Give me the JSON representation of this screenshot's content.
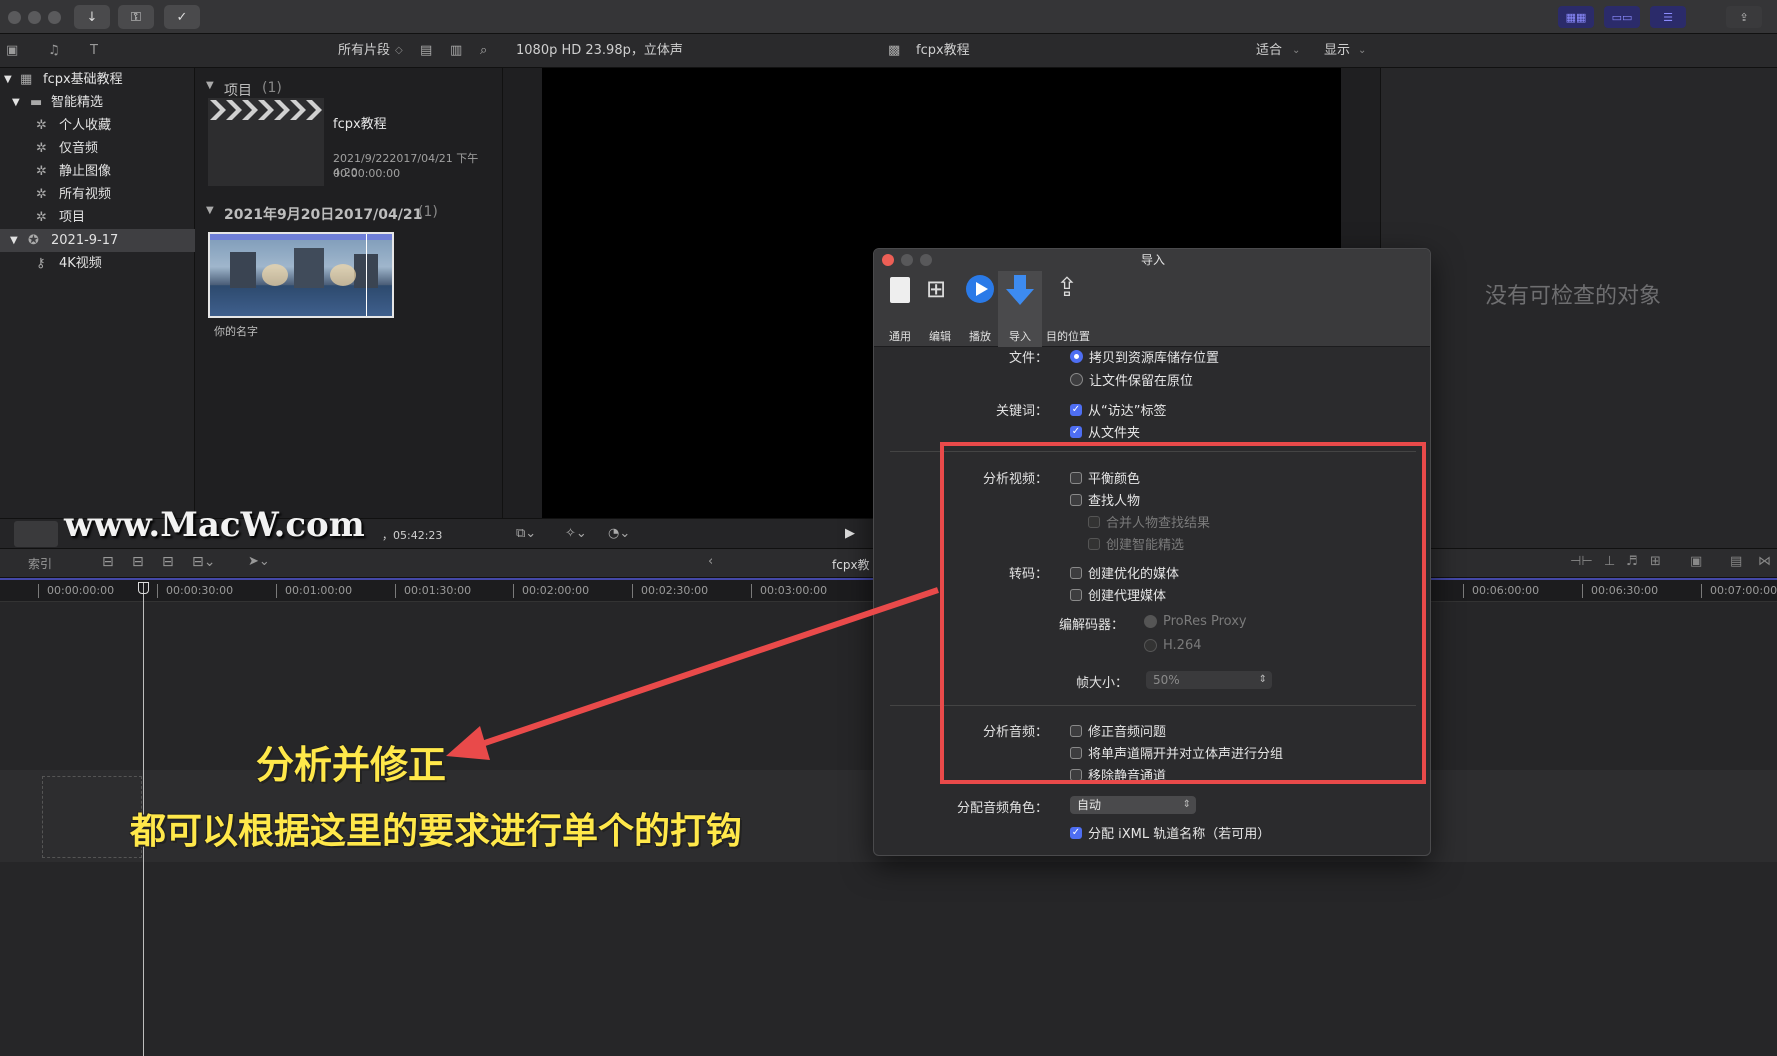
{
  "toolbar": {
    "filter_label": "所有片段",
    "format_info": "1080p HD 23.98p，立体声",
    "project_name": "fcpx教程",
    "zoom_label": "适合",
    "display_label": "显示"
  },
  "library": {
    "root": "fcpx基础教程",
    "smart_folder": "智能精选",
    "items": [
      "个人收藏",
      "仅音频",
      "静止图像",
      "所有视频",
      "项目"
    ],
    "event": "2021-9-17",
    "keyword": "4K视频"
  },
  "browser": {
    "project_header": "项目",
    "project_count": "(1)",
    "project_name": "fcpx教程",
    "project_date": "2021/9/222017/04/21 下午4:20",
    "project_duration": "00:00:00:00",
    "event_header": "2021年9月20日2017/04/21",
    "event_count": "(1)",
    "clip_name": "你的名字",
    "status_text": "，05:42:23"
  },
  "inspector": {
    "empty_text": "没有可检查的对象"
  },
  "timeline": {
    "index_label": "索引",
    "project_name": "fcpx教",
    "ticks": [
      "00:00:00:00",
      "00:00:30:00",
      "00:01:00:00",
      "00:01:30:00",
      "00:02:00:00",
      "00:02:30:00",
      "00:03:00:00"
    ],
    "ticks_right": [
      "00:06:00:00",
      "00:06:30:00",
      "00:07:00:00"
    ]
  },
  "dialog": {
    "title": "导入",
    "tabs": [
      "通用",
      "编辑",
      "播放",
      "导入",
      "目的位置"
    ],
    "files_label": "文件：",
    "files_copy": "拷贝到资源库储存位置",
    "files_leave": "让文件保留在原位",
    "keywords_label": "关键词：",
    "kw_finder": "从“访达”标签",
    "kw_folder": "从文件夹",
    "analyze_video_label": "分析视频：",
    "balance_color": "平衡颜色",
    "find_people": "查找人物",
    "consolidate": "合并人物查找结果",
    "smart_collections": "创建智能精选",
    "transcode_label": "转码：",
    "optimized": "创建优化的媒体",
    "proxy": "创建代理媒体",
    "codec_label": "编解码器：",
    "codec_prores": "ProRes Proxy",
    "codec_h264": "H.264",
    "frame_size_label": "帧大小：",
    "frame_size_value": "50%",
    "analyze_audio_label": "分析音频：",
    "fix_audio": "修正音频问题",
    "separate_mono": "将单声道隔开并对立体声进行分组",
    "remove_silent": "移除静音通道",
    "assign_roles_label": "分配音频角色：",
    "assign_roles_value": "自动",
    "ixml": "分配 iXML 轨道名称（若可用）"
  },
  "annotation": {
    "watermark": "www.MacW.com",
    "callout": "分析并修正",
    "caption": "都可以根据这里的要求进行单个的打钩",
    "color_box": "#e94a4a",
    "color_text": "#ffe84a"
  }
}
